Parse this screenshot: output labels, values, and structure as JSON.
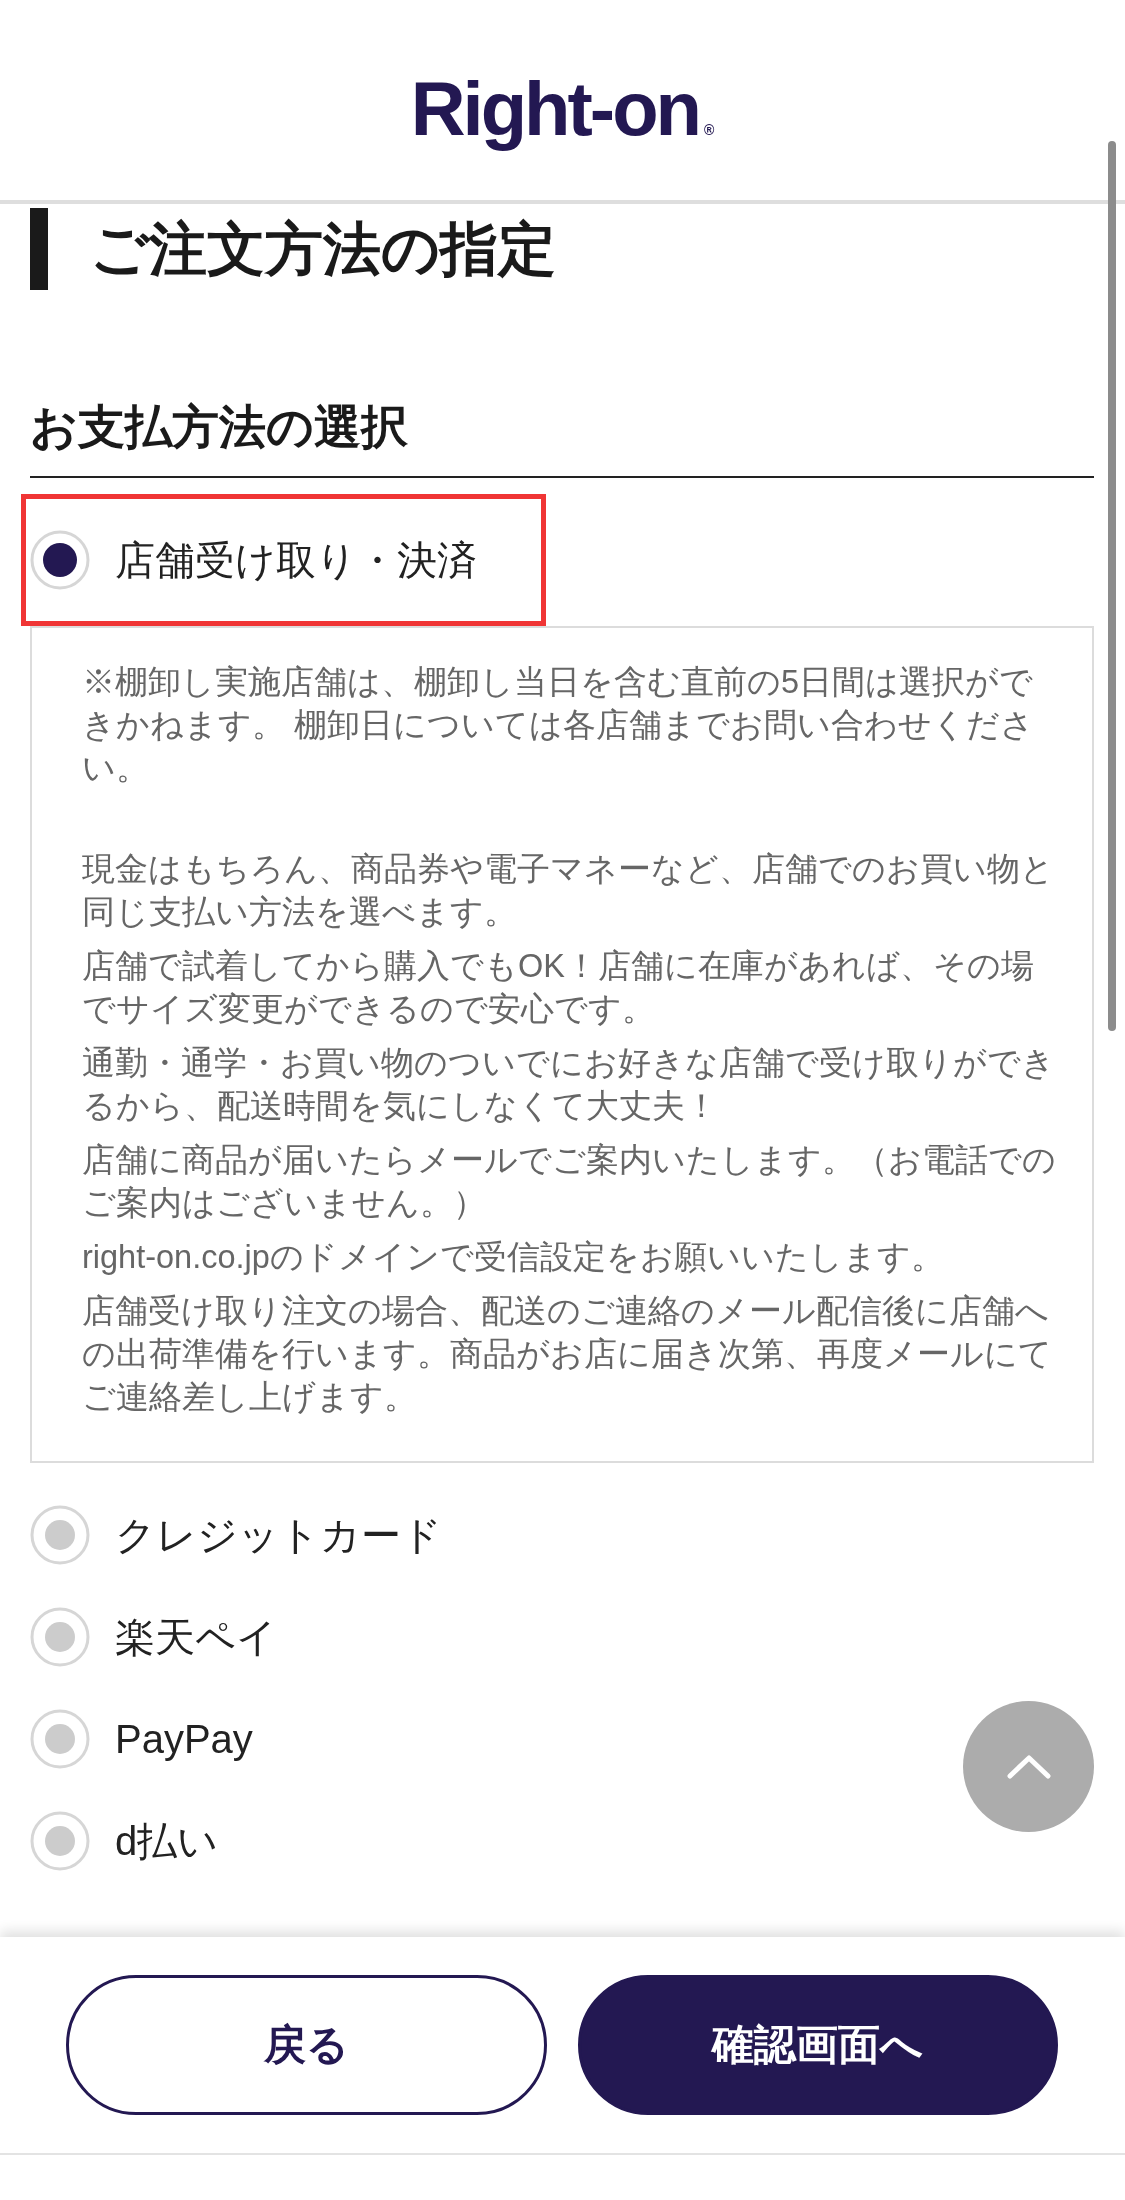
{
  "header": {
    "logo": {
      "text": "Right-on",
      "mark": "®"
    }
  },
  "page_title": "ご注文方法の指定",
  "payment_section": {
    "heading": "お支払方法の選択",
    "options": [
      {
        "label": "店舗受け取り・決済",
        "selected": true,
        "highlighted": true,
        "details": {
          "notice": "※棚卸し実施店舗は、棚卸し当日を含む直前の5日間は選択ができかねます。 棚卸日については各店舗までお問い合わせください。",
          "paragraphs": [
            "現金はもちろん、商品券や電子マネーなど、店舗でのお買い物と同じ支払い方法を選べます。",
            "店舗で試着してから購入でもOK！店舗に在庫があれば、その場でサイズ変更ができるので安心です。",
            "通勤・通学・お買い物のついでにお好きな店舗で受け取りができるから、配送時間を気にしなくて大丈夫！",
            "店舗に商品が届いたらメールでご案内いたします。（お電話でのご案内はございません。）",
            "right-on.co.jpのドメインで受信設定をお願いいたします。",
            "店舗受け取り注文の場合、配送のご連絡のメール配信後に店舗への出荷準備を行います。商品がお店に届き次第、再度メールにてご連絡差し上げます。"
          ]
        }
      },
      {
        "label": "クレジットカード",
        "selected": false,
        "highlighted": false
      },
      {
        "label": "楽天ペイ",
        "selected": false,
        "highlighted": false
      },
      {
        "label": "PayPay",
        "selected": false,
        "highlighted": false
      },
      {
        "label": "d払い",
        "selected": false,
        "highlighted": false
      }
    ]
  },
  "footer": {
    "buttons": [
      {
        "label": "戻る",
        "kind": "back"
      },
      {
        "label": "確認画面へ",
        "kind": "next"
      }
    ]
  }
}
